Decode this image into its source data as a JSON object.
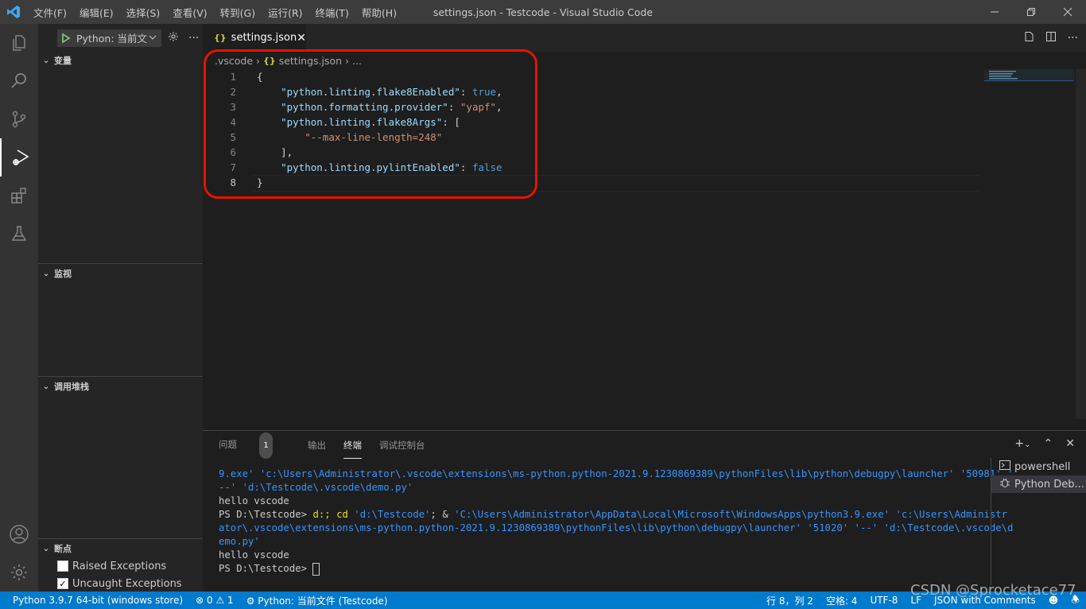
{
  "titlebar": {
    "menu": [
      "文件(F)",
      "编辑(E)",
      "选择(S)",
      "查看(V)",
      "转到(G)",
      "运行(R)",
      "终端(T)",
      "帮助(H)"
    ],
    "title": "settings.json - Testcode - Visual Studio Code"
  },
  "sidebar": {
    "run_config": "Python: 当前文",
    "sections": {
      "variables": "变量",
      "watch": "监视",
      "callstack": "调用堆栈",
      "breakpoints": "断点"
    },
    "breakpoints": [
      {
        "label": "Raised Exceptions",
        "checked": false
      },
      {
        "label": "Uncaught Exceptions",
        "checked": true
      }
    ]
  },
  "editor": {
    "tab_icon": "{}",
    "tab_label": "settings.json",
    "breadcrumb": {
      "folder": ".vscode",
      "file": "settings.json",
      "more": "..."
    },
    "line_numbers": [
      "1",
      "2",
      "3",
      "4",
      "5",
      "6",
      "7",
      "8"
    ],
    "lines": [
      {
        "a": "{"
      },
      {
        "k": "\"python.linting.flake8Enabled\"",
        "c": ": ",
        "v": "true",
        "e": ","
      },
      {
        "k": "\"python.formatting.provider\"",
        "c": ": ",
        "s": "\"yapf\"",
        "e": ","
      },
      {
        "k": "\"python.linting.flake8Args\"",
        "c": ": ",
        "e": "["
      },
      {
        "s": "\"--max-line-length=248\""
      },
      {
        "a": "],"
      },
      {
        "k": "\"python.linting.pylintEnabled\"",
        "c": ": ",
        "v": "false"
      },
      {
        "a": "}"
      }
    ]
  },
  "panel": {
    "tabs": {
      "problems": "问题",
      "problems_count": "1",
      "output": "输出",
      "terminal": "终端",
      "debug_console": "调试控制台"
    },
    "terminal_lines": {
      "l1": "9.exe' 'c:\\Users\\Administrator\\.vscode\\extensions\\ms-python.python-2021.9.1230869389\\pythonFiles\\lib\\python\\debugpy\\launcher' '50981' '",
      "l2": "--' 'd:\\Testcode\\.vscode\\demo.py'",
      "l3": "hello vscode",
      "l4_prompt": "PS D:\\Testcode> ",
      "l4_cmd1": "d:; cd ",
      "l4_str1": "'d:\\Testcode'",
      "l4_mid": "; & ",
      "l4_str2": "'C:\\Users\\Administrator\\AppData\\Local\\Microsoft\\WindowsApps\\python3.9.exe' 'c:\\Users\\Administr",
      "l5": "ator\\.vscode\\extensions\\ms-python.python-2021.9.1230869389\\pythonFiles\\lib\\python\\debugpy\\launcher' '51020' '--' 'd:\\Testcode\\.vscode\\d",
      "l6": "emo.py'",
      "l7": "hello vscode",
      "l8_prompt": "PS D:\\Testcode> "
    },
    "terminal_list": [
      "powershell",
      "Python Deb..."
    ]
  },
  "statusbar": {
    "interpreter": "Python 3.9.7 64-bit (windows store)",
    "errors": "⊗ 0",
    "warnings": "⚠ 1",
    "debug_config": "Python: 当前文件 (Testcode)",
    "position": "行 8，列 2",
    "spaces": "空格: 4",
    "encoding": "UTF-8",
    "eol": "LF",
    "language": "JSON with Comments"
  },
  "watermark": "CSDN @Sprocketace77",
  "colors": {
    "accent": "#007acc",
    "highlight_box": "#e51400",
    "json_key": "#9cdcfe",
    "json_string": "#ce9178",
    "json_bool": "#569cd6"
  }
}
